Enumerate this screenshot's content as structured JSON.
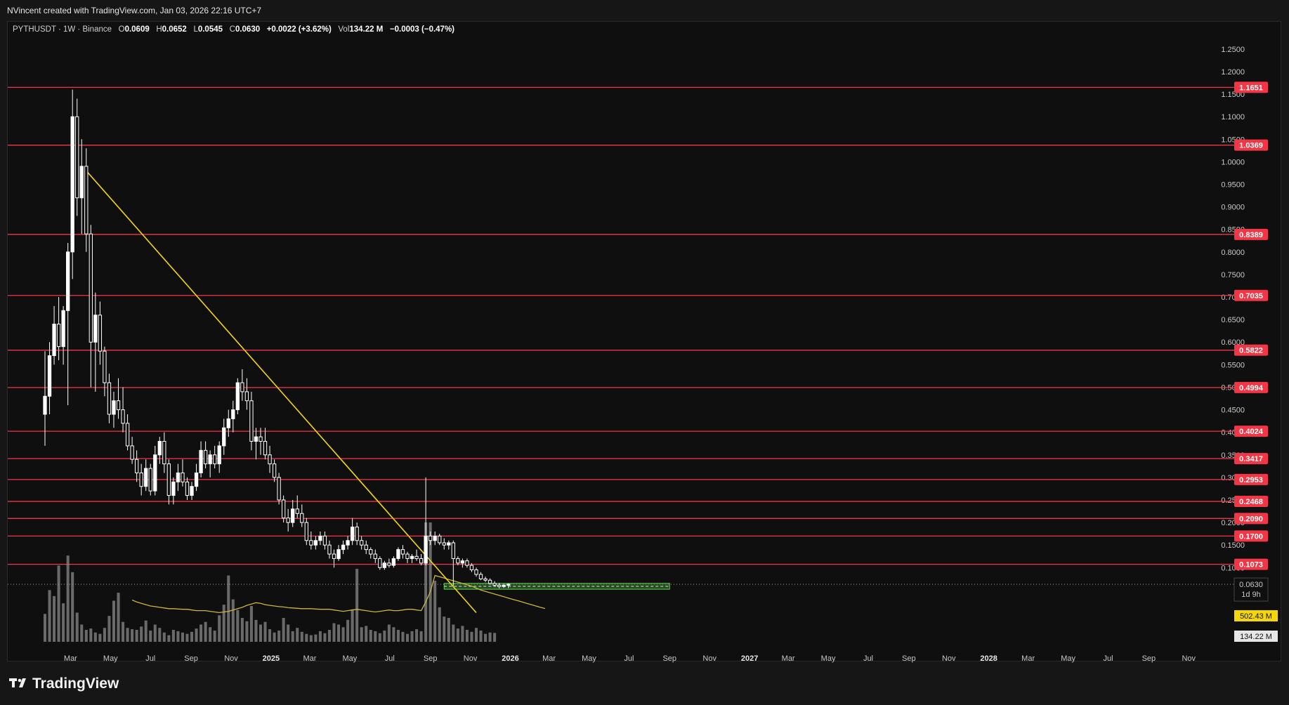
{
  "header": {
    "attribution": "NVincent created with TradingView.com, Jan 03, 2026 22:16 UTC+7"
  },
  "legend": {
    "symbol": "PYTHUSDT · 1W · Binance",
    "o_label": "O",
    "o": "0.0609",
    "h_label": "H",
    "h": "0.0652",
    "l_label": "L",
    "l": "0.0545",
    "c_label": "C",
    "c": "0.0630",
    "change": "+0.0022 (+3.62%)",
    "vol_label": "Vol",
    "vol": "134.22 M",
    "vol_change": "−0.0003 (−0.47%)"
  },
  "footer": {
    "brand": "TradingView"
  },
  "colors": {
    "background": "#0f0f0f",
    "candle": "#ffffff",
    "level_line": "#f23645",
    "trendline": "#f5d60a",
    "zone_fill": "#3a7d2c",
    "zone_border": "#5fd35a",
    "volume_bar": "#8a8a8a",
    "volume_ma": "#c9b640"
  },
  "chart_data": {
    "type": "candlestick",
    "timeframe": "1W",
    "y_axis": {
      "labels": [
        "1.2500",
        "1.2000",
        "1.1500",
        "1.1000",
        "1.0500",
        "1.0000",
        "0.9500",
        "0.9000",
        "0.8500",
        "0.8000",
        "0.7500",
        "0.7000",
        "0.6500",
        "0.6000",
        "0.5500",
        "0.5000",
        "0.4500",
        "0.4000",
        "0.3500",
        "0.3000",
        "0.2500",
        "0.2000",
        "0.1500",
        "0.1000"
      ],
      "ylim": [
        0.06,
        1.27
      ]
    },
    "x_axis": {
      "labels": [
        "Mar",
        "May",
        "Jul",
        "Sep",
        "Nov",
        "2025",
        "Mar",
        "May",
        "Jul",
        "Sep",
        "Nov",
        "2026",
        "Mar",
        "May",
        "Jul",
        "Sep",
        "Nov",
        "2027",
        "Mar",
        "May",
        "Jul",
        "Sep",
        "Nov",
        "2028",
        "Mar",
        "May",
        "Jul",
        "Sep",
        "Nov"
      ],
      "year_labels": [
        "2025",
        "2026",
        "2027",
        "2028"
      ],
      "xlim": [
        "2024-01-22",
        "2028-12-05"
      ]
    },
    "horizontal_levels": [
      1.1651,
      1.0369,
      0.8389,
      0.7035,
      0.5822,
      0.4994,
      0.4024,
      0.3417,
      0.2953,
      0.2468,
      0.209,
      0.17,
      0.1073
    ],
    "level_labels": [
      "1.1651",
      "1.0369",
      "0.8389",
      "0.7035",
      "0.5822",
      "0.4994",
      "0.4024",
      "0.3417",
      "0.2953",
      "0.2468",
      "0.2090",
      "0.1700",
      "0.1073"
    ],
    "last_price": {
      "value": 0.063,
      "label": "0.0630",
      "countdown": "1d 9h"
    },
    "trendline": {
      "start": {
        "date": "2024-03-25",
        "price": 0.98
      },
      "end": {
        "date": "2025-11-10",
        "price": 0.0
      }
    },
    "support_zone": {
      "start": "2025-09-22",
      "end": "2026-09-01",
      "top": 0.065,
      "bottom": 0.052
    },
    "ohlc": [
      {
        "t": "2024-01-22",
        "o": 0.44,
        "h": 0.58,
        "l": 0.37,
        "c": 0.48
      },
      {
        "t": "2024-01-29",
        "o": 0.48,
        "h": 0.6,
        "l": 0.44,
        "c": 0.57
      },
      {
        "t": "2024-02-05",
        "o": 0.57,
        "h": 0.68,
        "l": 0.55,
        "c": 0.64
      },
      {
        "t": "2024-02-12",
        "o": 0.64,
        "h": 0.7,
        "l": 0.56,
        "c": 0.59
      },
      {
        "t": "2024-02-19",
        "o": 0.59,
        "h": 0.68,
        "l": 0.55,
        "c": 0.67
      },
      {
        "t": "2024-02-26",
        "o": 0.67,
        "h": 0.82,
        "l": 0.46,
        "c": 0.8
      },
      {
        "t": "2024-03-04",
        "o": 0.8,
        "h": 1.16,
        "l": 0.74,
        "c": 1.1
      },
      {
        "t": "2024-03-11",
        "o": 1.1,
        "h": 1.14,
        "l": 0.88,
        "c": 0.92
      },
      {
        "t": "2024-03-18",
        "o": 0.92,
        "h": 1.05,
        "l": 0.84,
        "c": 0.99
      },
      {
        "t": "2024-03-25",
        "o": 0.99,
        "h": 1.03,
        "l": 0.8,
        "c": 0.84
      },
      {
        "t": "2024-04-01",
        "o": 0.84,
        "h": 0.86,
        "l": 0.5,
        "c": 0.6
      },
      {
        "t": "2024-04-08",
        "o": 0.6,
        "h": 0.71,
        "l": 0.49,
        "c": 0.66
      },
      {
        "t": "2024-04-15",
        "o": 0.66,
        "h": 0.69,
        "l": 0.55,
        "c": 0.58
      },
      {
        "t": "2024-04-22",
        "o": 0.58,
        "h": 0.59,
        "l": 0.48,
        "c": 0.51
      },
      {
        "t": "2024-04-29",
        "o": 0.51,
        "h": 0.53,
        "l": 0.42,
        "c": 0.44
      },
      {
        "t": "2024-05-06",
        "o": 0.44,
        "h": 0.49,
        "l": 0.41,
        "c": 0.47
      },
      {
        "t": "2024-05-13",
        "o": 0.47,
        "h": 0.52,
        "l": 0.43,
        "c": 0.45
      },
      {
        "t": "2024-05-20",
        "o": 0.45,
        "h": 0.5,
        "l": 0.4,
        "c": 0.42
      },
      {
        "t": "2024-05-27",
        "o": 0.42,
        "h": 0.44,
        "l": 0.36,
        "c": 0.37
      },
      {
        "t": "2024-06-03",
        "o": 0.37,
        "h": 0.39,
        "l": 0.33,
        "c": 0.34
      },
      {
        "t": "2024-06-10",
        "o": 0.34,
        "h": 0.36,
        "l": 0.29,
        "c": 0.31
      },
      {
        "t": "2024-06-17",
        "o": 0.31,
        "h": 0.33,
        "l": 0.26,
        "c": 0.28
      },
      {
        "t": "2024-06-24",
        "o": 0.28,
        "h": 0.34,
        "l": 0.27,
        "c": 0.32
      },
      {
        "t": "2024-07-01",
        "o": 0.32,
        "h": 0.33,
        "l": 0.26,
        "c": 0.27
      },
      {
        "t": "2024-07-08",
        "o": 0.27,
        "h": 0.37,
        "l": 0.26,
        "c": 0.35
      },
      {
        "t": "2024-07-15",
        "o": 0.35,
        "h": 0.39,
        "l": 0.33,
        "c": 0.38
      },
      {
        "t": "2024-07-22",
        "o": 0.38,
        "h": 0.4,
        "l": 0.31,
        "c": 0.33
      },
      {
        "t": "2024-07-29",
        "o": 0.33,
        "h": 0.34,
        "l": 0.24,
        "c": 0.26
      },
      {
        "t": "2024-08-05",
        "o": 0.26,
        "h": 0.3,
        "l": 0.24,
        "c": 0.29
      },
      {
        "t": "2024-08-12",
        "o": 0.29,
        "h": 0.33,
        "l": 0.27,
        "c": 0.31
      },
      {
        "t": "2024-08-19",
        "o": 0.31,
        "h": 0.34,
        "l": 0.28,
        "c": 0.29
      },
      {
        "t": "2024-08-26",
        "o": 0.29,
        "h": 0.3,
        "l": 0.25,
        "c": 0.26
      },
      {
        "t": "2024-09-02",
        "o": 0.26,
        "h": 0.29,
        "l": 0.25,
        "c": 0.28
      },
      {
        "t": "2024-09-09",
        "o": 0.28,
        "h": 0.33,
        "l": 0.27,
        "c": 0.31
      },
      {
        "t": "2024-09-16",
        "o": 0.31,
        "h": 0.38,
        "l": 0.3,
        "c": 0.36
      },
      {
        "t": "2024-09-23",
        "o": 0.36,
        "h": 0.38,
        "l": 0.32,
        "c": 0.33
      },
      {
        "t": "2024-09-30",
        "o": 0.33,
        "h": 0.36,
        "l": 0.3,
        "c": 0.35
      },
      {
        "t": "2024-10-07",
        "o": 0.35,
        "h": 0.37,
        "l": 0.32,
        "c": 0.33
      },
      {
        "t": "2024-10-14",
        "o": 0.33,
        "h": 0.38,
        "l": 0.31,
        "c": 0.37
      },
      {
        "t": "2024-10-21",
        "o": 0.37,
        "h": 0.43,
        "l": 0.35,
        "c": 0.41
      },
      {
        "t": "2024-10-28",
        "o": 0.41,
        "h": 0.45,
        "l": 0.39,
        "c": 0.43
      },
      {
        "t": "2024-11-04",
        "o": 0.43,
        "h": 0.47,
        "l": 0.4,
        "c": 0.45
      },
      {
        "t": "2024-11-11",
        "o": 0.45,
        "h": 0.52,
        "l": 0.44,
        "c": 0.51
      },
      {
        "t": "2024-11-18",
        "o": 0.51,
        "h": 0.54,
        "l": 0.47,
        "c": 0.49
      },
      {
        "t": "2024-11-25",
        "o": 0.49,
        "h": 0.52,
        "l": 0.45,
        "c": 0.47
      },
      {
        "t": "2024-12-02",
        "o": 0.47,
        "h": 0.49,
        "l": 0.36,
        "c": 0.38
      },
      {
        "t": "2024-12-09",
        "o": 0.38,
        "h": 0.41,
        "l": 0.34,
        "c": 0.39
      },
      {
        "t": "2024-12-16",
        "o": 0.39,
        "h": 0.41,
        "l": 0.35,
        "c": 0.38
      },
      {
        "t": "2024-12-23",
        "o": 0.38,
        "h": 0.41,
        "l": 0.34,
        "c": 0.35
      },
      {
        "t": "2024-12-30",
        "o": 0.35,
        "h": 0.37,
        "l": 0.31,
        "c": 0.33
      },
      {
        "t": "2025-01-06",
        "o": 0.33,
        "h": 0.34,
        "l": 0.29,
        "c": 0.3
      },
      {
        "t": "2025-01-13",
        "o": 0.3,
        "h": 0.31,
        "l": 0.24,
        "c": 0.25
      },
      {
        "t": "2025-01-20",
        "o": 0.25,
        "h": 0.26,
        "l": 0.2,
        "c": 0.21
      },
      {
        "t": "2025-01-27",
        "o": 0.21,
        "h": 0.23,
        "l": 0.18,
        "c": 0.2
      },
      {
        "t": "2025-02-03",
        "o": 0.2,
        "h": 0.25,
        "l": 0.19,
        "c": 0.23
      },
      {
        "t": "2025-02-10",
        "o": 0.23,
        "h": 0.26,
        "l": 0.21,
        "c": 0.22
      },
      {
        "t": "2025-02-17",
        "o": 0.22,
        "h": 0.24,
        "l": 0.19,
        "c": 0.2
      },
      {
        "t": "2025-02-24",
        "o": 0.2,
        "h": 0.21,
        "l": 0.15,
        "c": 0.16
      },
      {
        "t": "2025-03-03",
        "o": 0.16,
        "h": 0.18,
        "l": 0.14,
        "c": 0.15
      },
      {
        "t": "2025-03-10",
        "o": 0.15,
        "h": 0.17,
        "l": 0.14,
        "c": 0.16
      },
      {
        "t": "2025-03-17",
        "o": 0.16,
        "h": 0.18,
        "l": 0.15,
        "c": 0.17
      },
      {
        "t": "2025-03-24",
        "o": 0.17,
        "h": 0.18,
        "l": 0.14,
        "c": 0.15
      },
      {
        "t": "2025-03-31",
        "o": 0.15,
        "h": 0.16,
        "l": 0.12,
        "c": 0.13
      },
      {
        "t": "2025-04-07",
        "o": 0.13,
        "h": 0.14,
        "l": 0.1,
        "c": 0.12
      },
      {
        "t": "2025-04-14",
        "o": 0.12,
        "h": 0.15,
        "l": 0.115,
        "c": 0.14
      },
      {
        "t": "2025-04-21",
        "o": 0.14,
        "h": 0.16,
        "l": 0.13,
        "c": 0.15
      },
      {
        "t": "2025-04-28",
        "o": 0.15,
        "h": 0.17,
        "l": 0.14,
        "c": 0.16
      },
      {
        "t": "2025-05-05",
        "o": 0.16,
        "h": 0.21,
        "l": 0.15,
        "c": 0.19
      },
      {
        "t": "2025-05-12",
        "o": 0.19,
        "h": 0.2,
        "l": 0.15,
        "c": 0.16
      },
      {
        "t": "2025-05-19",
        "o": 0.16,
        "h": 0.17,
        "l": 0.14,
        "c": 0.15
      },
      {
        "t": "2025-05-26",
        "o": 0.15,
        "h": 0.16,
        "l": 0.13,
        "c": 0.14
      },
      {
        "t": "2025-06-02",
        "o": 0.14,
        "h": 0.145,
        "l": 0.12,
        "c": 0.13
      },
      {
        "t": "2025-06-09",
        "o": 0.13,
        "h": 0.14,
        "l": 0.11,
        "c": 0.12
      },
      {
        "t": "2025-06-16",
        "o": 0.12,
        "h": 0.125,
        "l": 0.095,
        "c": 0.1
      },
      {
        "t": "2025-06-23",
        "o": 0.1,
        "h": 0.115,
        "l": 0.095,
        "c": 0.11
      },
      {
        "t": "2025-06-30",
        "o": 0.11,
        "h": 0.12,
        "l": 0.1,
        "c": 0.105
      },
      {
        "t": "2025-07-07",
        "o": 0.105,
        "h": 0.125,
        "l": 0.1,
        "c": 0.12
      },
      {
        "t": "2025-07-14",
        "o": 0.12,
        "h": 0.145,
        "l": 0.115,
        "c": 0.14
      },
      {
        "t": "2025-07-21",
        "o": 0.14,
        "h": 0.15,
        "l": 0.12,
        "c": 0.13
      },
      {
        "t": "2025-07-28",
        "o": 0.13,
        "h": 0.135,
        "l": 0.11,
        "c": 0.12
      },
      {
        "t": "2025-08-04",
        "o": 0.12,
        "h": 0.13,
        "l": 0.11,
        "c": 0.125
      },
      {
        "t": "2025-08-11",
        "o": 0.125,
        "h": 0.14,
        "l": 0.115,
        "c": 0.12
      },
      {
        "t": "2025-08-18",
        "o": 0.12,
        "h": 0.13,
        "l": 0.105,
        "c": 0.11
      },
      {
        "t": "2025-08-25",
        "o": 0.11,
        "h": 0.3,
        "l": 0.105,
        "c": 0.17
      },
      {
        "t": "2025-09-01",
        "o": 0.17,
        "h": 0.18,
        "l": 0.15,
        "c": 0.16
      },
      {
        "t": "2025-09-08",
        "o": 0.16,
        "h": 0.18,
        "l": 0.15,
        "c": 0.17
      },
      {
        "t": "2025-09-15",
        "o": 0.17,
        "h": 0.175,
        "l": 0.15,
        "c": 0.155
      },
      {
        "t": "2025-09-22",
        "o": 0.155,
        "h": 0.165,
        "l": 0.14,
        "c": 0.15
      },
      {
        "t": "2025-09-29",
        "o": 0.15,
        "h": 0.16,
        "l": 0.14,
        "c": 0.155
      },
      {
        "t": "2025-10-06",
        "o": 0.155,
        "h": 0.16,
        "l": 0.06,
        "c": 0.12
      },
      {
        "t": "2025-10-13",
        "o": 0.12,
        "h": 0.125,
        "l": 0.105,
        "c": 0.11
      },
      {
        "t": "2025-10-20",
        "o": 0.11,
        "h": 0.12,
        "l": 0.1,
        "c": 0.115
      },
      {
        "t": "2025-10-27",
        "o": 0.115,
        "h": 0.12,
        "l": 0.1,
        "c": 0.105
      },
      {
        "t": "2025-11-03",
        "o": 0.105,
        "h": 0.11,
        "l": 0.09,
        "c": 0.095
      },
      {
        "t": "2025-11-10",
        "o": 0.095,
        "h": 0.1,
        "l": 0.08,
        "c": 0.085
      },
      {
        "t": "2025-11-17",
        "o": 0.085,
        "h": 0.09,
        "l": 0.072,
        "c": 0.075
      },
      {
        "t": "2025-11-24",
        "o": 0.075,
        "h": 0.08,
        "l": 0.068,
        "c": 0.072
      },
      {
        "t": "2025-12-01",
        "o": 0.072,
        "h": 0.076,
        "l": 0.062,
        "c": 0.065
      },
      {
        "t": "2025-12-08",
        "o": 0.065,
        "h": 0.07,
        "l": 0.058,
        "c": 0.061
      },
      {
        "t": "2025-12-15",
        "o": 0.061,
        "h": 0.066,
        "l": 0.054,
        "c": 0.058
      },
      {
        "t": "2025-12-22",
        "o": 0.058,
        "h": 0.064,
        "l": 0.055,
        "c": 0.061
      },
      {
        "t": "2025-12-29",
        "o": 0.0609,
        "h": 0.0652,
        "l": 0.0545,
        "c": 0.063
      }
    ],
    "volume": {
      "label_ma": "502.43 M",
      "label_current": "134.22 M",
      "unit": "M",
      "ma_start": "2024-06-03",
      "ylim": [
        0,
        1800
      ],
      "values": [
        420,
        780,
        690,
        1150,
        580,
        1300,
        1050,
        440,
        260,
        180,
        200,
        140,
        120,
        210,
        390,
        620,
        740,
        300,
        210,
        190,
        180,
        230,
        320,
        170,
        260,
        210,
        140,
        100,
        180,
        160,
        140,
        120,
        150,
        200,
        260,
        300,
        220,
        170,
        400,
        560,
        1000,
        640,
        480,
        360,
        310,
        540,
        330,
        260,
        300,
        190,
        140,
        170,
        360,
        260,
        160,
        210,
        150,
        120,
        100,
        110,
        160,
        130,
        180,
        280,
        260,
        220,
        330,
        490,
        1100,
        220,
        240,
        180,
        160,
        130,
        170,
        260,
        220,
        180,
        150,
        120,
        160,
        190,
        160,
        4300,
        1900,
        920,
        520,
        380,
        360,
        260,
        200,
        240,
        180,
        150,
        210,
        170,
        120,
        140,
        134
      ],
      "ma_values": [
        630,
        600,
        580,
        560,
        540,
        530,
        520,
        510,
        500,
        500,
        495,
        490,
        490,
        480,
        470,
        470,
        470,
        460,
        450,
        440,
        450,
        460,
        480,
        500,
        520,
        550,
        570,
        590,
        580,
        560,
        550,
        540,
        530,
        525,
        515,
        510,
        505,
        500,
        500,
        500,
        495,
        490,
        490,
        490,
        480,
        470,
        460,
        470,
        480,
        490,
        480,
        470,
        460,
        450,
        460,
        470,
        480,
        470,
        470,
        480,
        490,
        490,
        480,
        470,
        600,
        760,
        1000,
        980,
        960,
        940,
        920,
        900,
        880,
        860,
        840,
        810,
        780,
        760,
        740,
        720,
        700,
        680,
        660,
        640,
        620,
        600,
        580,
        560,
        540,
        520,
        502
      ]
    }
  }
}
